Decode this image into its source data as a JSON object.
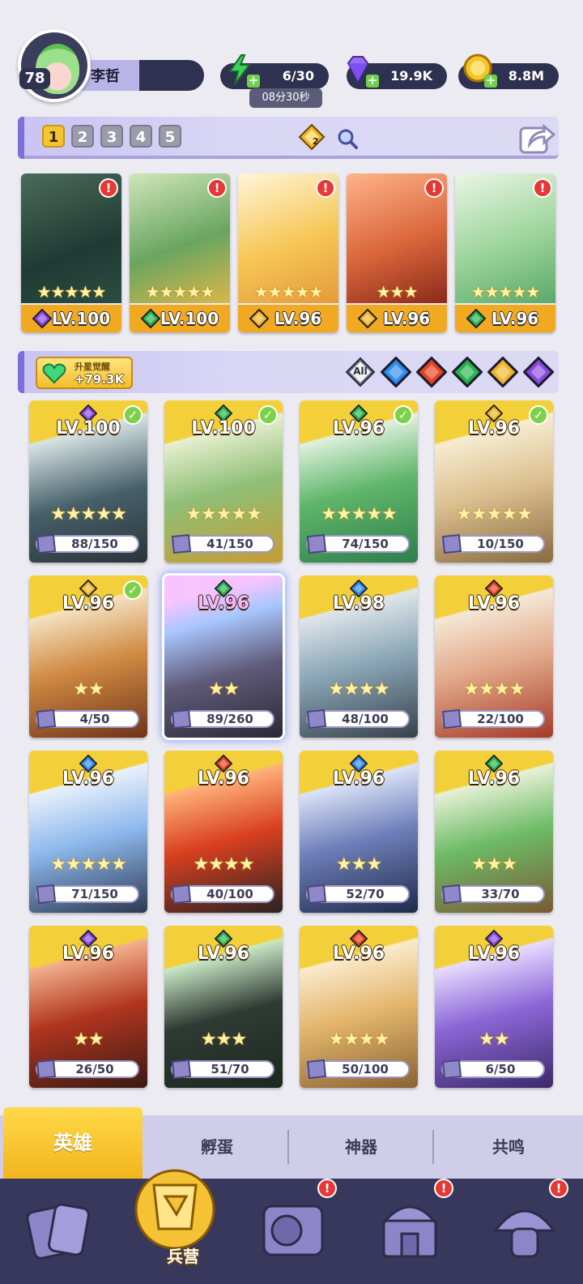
{
  "player": {
    "level": "78",
    "name": "李哲"
  },
  "resources": {
    "energy": "6/30",
    "energy_timer": "08分30秒",
    "gems": "19.9K",
    "gold": "8.8M"
  },
  "team_tabs": [
    "1",
    "2",
    "3",
    "4",
    "5"
  ],
  "team_badge": "2",
  "team": [
    {
      "level": "LV.100",
      "element": "dark",
      "stars": "★★★★★"
    },
    {
      "level": "LV.100",
      "element": "nature",
      "stars": "★★★★★"
    },
    {
      "level": "LV.96",
      "element": "light",
      "stars": "★★★★★"
    },
    {
      "level": "LV.96",
      "element": "light",
      "stars": "★★★"
    },
    {
      "level": "LV.96",
      "element": "nature",
      "stars": "★★★★★"
    }
  ],
  "awaken": {
    "label": "升星觉醒",
    "value": "+79.3K"
  },
  "filters": [
    "All",
    "water",
    "fire",
    "nature",
    "light",
    "dark"
  ],
  "filter_all_label": "All",
  "heroes": [
    {
      "level": "LV.100",
      "element": "dark",
      "progress": "88/150",
      "stars": "★★★★★",
      "checked": true
    },
    {
      "level": "LV.100",
      "element": "nature",
      "progress": "41/150",
      "stars": "★★★★★",
      "checked": true
    },
    {
      "level": "LV.96",
      "element": "nature",
      "progress": "74/150",
      "stars": "★★★★★",
      "checked": true
    },
    {
      "level": "LV.96",
      "element": "light",
      "progress": "10/150",
      "stars": "★★★★★",
      "checked": true
    },
    {
      "level": "LV.96",
      "element": "light",
      "progress": "4/50",
      "stars": "★★",
      "checked": true
    },
    {
      "level": "LV.96",
      "element": "nature",
      "progress": "89/260",
      "stars": "★★",
      "checked": false,
      "selected": true
    },
    {
      "level": "LV.98",
      "element": "water",
      "progress": "48/100",
      "stars": "★★★★",
      "checked": false
    },
    {
      "level": "LV.96",
      "element": "fire",
      "progress": "22/100",
      "stars": "★★★★",
      "checked": false
    },
    {
      "level": "LV.96",
      "element": "water",
      "progress": "71/150",
      "stars": "★★★★★",
      "checked": false
    },
    {
      "level": "LV.96",
      "element": "fire",
      "progress": "40/100",
      "stars": "★★★★",
      "checked": false
    },
    {
      "level": "LV.96",
      "element": "water",
      "progress": "52/70",
      "stars": "★★★",
      "checked": false
    },
    {
      "level": "LV.96",
      "element": "nature",
      "progress": "33/70",
      "stars": "★★★",
      "checked": false
    },
    {
      "level": "LV.96",
      "element": "dark",
      "progress": "26/50",
      "stars": "★★",
      "checked": false
    },
    {
      "level": "LV.96",
      "element": "nature",
      "progress": "51/70",
      "stars": "★★★",
      "checked": false
    },
    {
      "level": "LV.96",
      "element": "fire",
      "progress": "50/100",
      "stars": "★★★★",
      "checked": false
    },
    {
      "level": "LV.96",
      "element": "dark",
      "progress": "6/50",
      "stars": "★★",
      "checked": false
    }
  ],
  "sub_tabs": [
    "英雄",
    "孵蛋",
    "神器",
    "共鸣"
  ],
  "nav": {
    "active_label": "兵营"
  },
  "colors": {
    "gold": "#f0a920",
    "water": "#2e8bf0",
    "fire": "#e8401f",
    "nature": "#27b24c",
    "light": "#f0b62a",
    "dark": "#8a48e0",
    "alert": "#e53935",
    "nav_bg": "#37385b"
  }
}
